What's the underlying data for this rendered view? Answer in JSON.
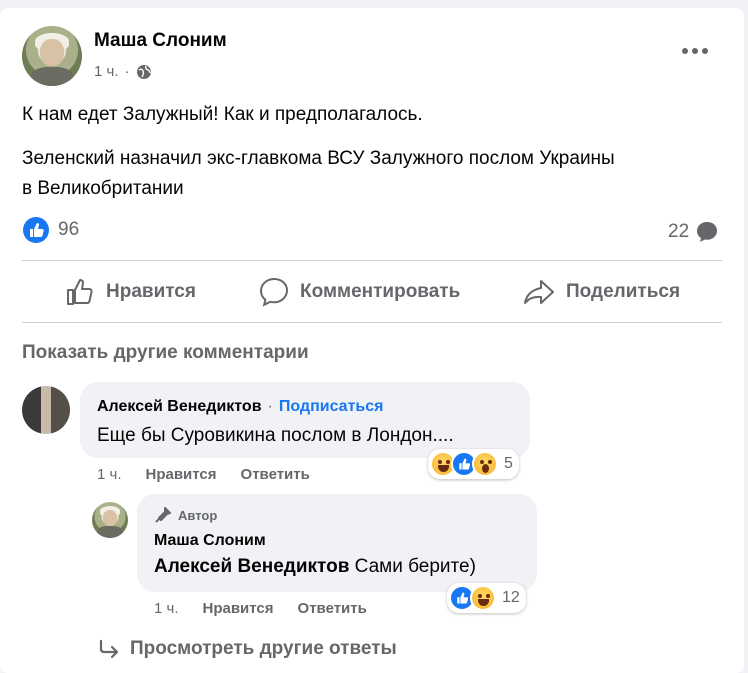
{
  "post": {
    "author": "Маша Слоним",
    "time": "1 ч.",
    "privacy_icon": "globe-icon",
    "more_icon": "more-icon",
    "text_line1": "К нам едет Залужный! Как и предполагалось.",
    "text_line2a": "Зеленский назначил экс-главкома ВСУ Залужного послом Украины",
    "text_line2b": "в Великобритании",
    "like_count": "96",
    "comment_count": "22"
  },
  "actions": {
    "like": "Нравится",
    "comment": "Комментировать",
    "share": "Поделиться"
  },
  "comments": {
    "show_more": "Показать другие комментарии",
    "c1": {
      "author": "Алексей Венедиктов",
      "dot": "·",
      "follow": "Подписаться",
      "text": "Еще бы Суровикина послом в Лондон....",
      "time": "1 ч.",
      "like": "Нравится",
      "reply": "Ответить",
      "reactions": "5"
    },
    "c2": {
      "badge": "Автор",
      "author": "Маша Слоним",
      "mention": "Алексей Венедиктов",
      "text": "Сами берите)",
      "time": "1 ч.",
      "like": "Нравится",
      "reply": "Ответить",
      "reactions": "12"
    },
    "view_more_replies": "Просмотреть другие ответы"
  },
  "colors": {
    "accent": "#1877f2",
    "secondary_text": "#65676b",
    "bubble": "#f0f2f5"
  }
}
